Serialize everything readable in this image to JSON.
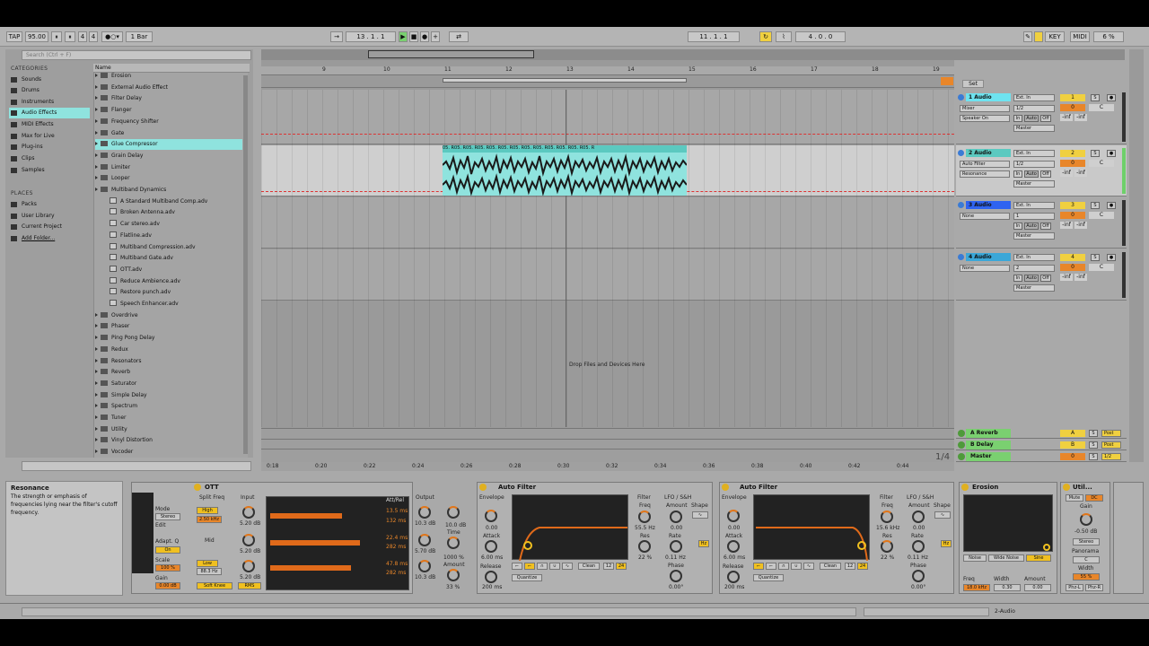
{
  "transport": {
    "tap": "TAP",
    "tempo": "95.00",
    "signature_num": "4",
    "signature_den": "4",
    "quantize": "1 Bar",
    "position": "13 . 1 . 1",
    "loop_start": "11 . 1 . 1",
    "loop_length": "4 . 0 . 0",
    "key": "KEY",
    "midi": "MIDI",
    "cpu": "6 %"
  },
  "browser": {
    "search_placeholder": "Search (Ctrl + F)",
    "categories_label": "CATEGORIES",
    "categories": [
      "Sounds",
      "Drums",
      "Instruments",
      "Audio Effects",
      "MIDI Effects",
      "Max for Live",
      "Plug-ins",
      "Clips",
      "Samples"
    ],
    "places_label": "PLACES",
    "places": [
      "Packs",
      "User Library",
      "Current Project",
      "Add Folder..."
    ],
    "name_header": "Name",
    "items_top": [
      "Erosion",
      "External Audio Effect",
      "Filter Delay",
      "Flanger",
      "Frequency Shifter",
      "Gate",
      "Glue Compressor",
      "Grain Delay",
      "Limiter",
      "Looper",
      "Multiband Dynamics"
    ],
    "presets": [
      "A Standard Multiband Comp.adv",
      "Broken Antenna.adv",
      "Car stereo.adv",
      "Flatline.adv",
      "Multiband Compression.adv",
      "Multiband Gate.adv",
      "OTT.adv",
      "Reduce Ambience.adv",
      "Restore punch.adv",
      "Speech Enhancer.adv"
    ],
    "items_bottom": [
      "Overdrive",
      "Phaser",
      "Ping Pong Delay",
      "Redux",
      "Resonators",
      "Reverb",
      "Saturator",
      "Simple Delay",
      "Spectrum",
      "Tuner",
      "Utility",
      "Vinyl Distortion",
      "Vocoder"
    ]
  },
  "arrangement": {
    "ruler": [
      "9",
      "10",
      "11",
      "12",
      "13",
      "14",
      "15",
      "16",
      "17",
      "18",
      "19"
    ],
    "times": [
      "0:18",
      "0:20",
      "0:22",
      "0:24",
      "0:26",
      "0:28",
      "0:30",
      "0:32",
      "0:34",
      "0:36",
      "0:38",
      "0:40",
      "0:42",
      "0:44"
    ],
    "drop_text": "Drop Files and Devices Here",
    "clip_label": "05.  R05.  R05.  R05.  R05.  R05.  R05.  R05.  R05.  R05.  R05.  R05.  R05.  R",
    "page": "1/4",
    "set_label": "Set"
  },
  "tracks": [
    {
      "name": "1 Audio",
      "color": "#6ee3f0",
      "num": "1",
      "in": "Ext. In",
      "ch": "1/2",
      "dev": "Mixer",
      "param": "Speaker On",
      "out": "Master",
      "vol": "0",
      "pan": "C",
      "inf": "-inf"
    },
    {
      "name": "2 Audio",
      "color": "#5bc9c0",
      "num": "2",
      "in": "Ext. In",
      "ch": "1/2",
      "dev": "Auto Filter",
      "param": "Resonance",
      "out": "Master",
      "vol": "0",
      "pan": "C",
      "inf": "-inf"
    },
    {
      "name": "3 Audio",
      "color": "#2f63f0",
      "num": "3",
      "in": "Ext. In",
      "ch": "1",
      "dev": "None",
      "param": "",
      "out": "Master",
      "vol": "0",
      "pan": "C",
      "inf": "-inf"
    },
    {
      "name": "4 Audio",
      "color": "#3ba7d8",
      "num": "4",
      "in": "Ext. In",
      "ch": "2",
      "dev": "None",
      "param": "",
      "out": "Master",
      "vol": "0",
      "pan": "C",
      "inf": "-inf"
    }
  ],
  "returns": [
    {
      "name": "A Reverb",
      "letter": "A",
      "color": "#7ad070",
      "post": "Post"
    },
    {
      "name": "B Delay",
      "letter": "B",
      "color": "#7ad070",
      "post": "Post"
    },
    {
      "name": "Master",
      "letter": "0",
      "color": "#7ad070",
      "post": "1/2"
    }
  ],
  "info": {
    "title": "Resonance",
    "body": "The strength or emphasis of frequencies lying near the filter's cutoff frequency."
  },
  "devices": {
    "ott": {
      "title": "OTT",
      "split": "Split Freq",
      "input": "Input",
      "output": "Output",
      "high": "High",
      "high_freq": "2.50 kHz",
      "mid": "Mid",
      "low": "Low",
      "low_freq": "88.3 Hz",
      "db1": "5.20 dB",
      "db2": "5.20 dB",
      "db3": "5.20 dB",
      "out1": "10.3 dB",
      "out2": "5.70 dB",
      "out3": "10.3 dB",
      "soft": "Soft Knee",
      "rms": "RMS",
      "time": "Time",
      "time_val": "1000 %",
      "amount": "Amount",
      "amount_val": "33 %",
      "outval": "10.0 dB",
      "att_rel": "Att/Rel",
      "ms1": "13.5 ms",
      "ms2": "132 ms",
      "ms3": "22.4 ms",
      "ms4": "282 ms",
      "ms5": "47.8 ms",
      "ms6": "282 ms",
      "mode": "Mode",
      "stereo": "Stereo",
      "edit": "Edit",
      "adapt": "Adapt. Q",
      "on": "On",
      "scale": "Scale",
      "scale_val": "100 %",
      "gain": "Gain",
      "gain_val": "0.00 dB"
    },
    "af1": {
      "title": "Auto Filter",
      "envelope": "Envelope",
      "env_val": "0.00",
      "attack": "Attack",
      "attack_val": "6.00 ms",
      "release": "Release",
      "release_val": "200 ms",
      "filter": "Filter",
      "freq": "Freq",
      "freq_val": "55.5 Hz",
      "res": "Res",
      "res_val": "22 %",
      "lfo": "LFO / S&H",
      "amount": "Amount",
      "amount_val": "0.00",
      "shape": "Shape",
      "rate": "Rate",
      "rate_val": "0.11 Hz",
      "phase": "Phase",
      "phase_val": "0.00°",
      "clean": "Clean",
      "quantize": "Quantize"
    },
    "af2": {
      "title": "Auto Filter",
      "envelope": "Envelope",
      "env_val": "0.00",
      "attack": "Attack",
      "attack_val": "6.00 ms",
      "release": "Release",
      "release_val": "200 ms",
      "filter": "Filter",
      "freq": "Freq",
      "freq_val": "15.6 kHz",
      "res": "Res",
      "res_val": "22 %",
      "lfo": "LFO / S&H",
      "amount": "Amount",
      "amount_val": "0.00",
      "shape": "Shape",
      "rate": "Rate",
      "rate_val": "0.11 Hz",
      "phase": "Phase",
      "phase_val": "0.00°",
      "clean": "Clean",
      "quantize": "Quantize"
    },
    "erosion": {
      "title": "Erosion",
      "noise": "Noise",
      "wide": "Wide Noise",
      "sine": "Sine",
      "freq": "Freq",
      "freq_val": "18.0 kHz",
      "width": "Width",
      "width_val": "0.30",
      "amount": "Amount",
      "amount_val": "0.00"
    },
    "utility": {
      "title": "Util...",
      "mute": "Mute",
      "dc": "DC",
      "gain": "Gain",
      "gain_val": "-0.50 dB",
      "stereo": "Stereo",
      "panorama": "Panorama",
      "pan_val": "C",
      "width": "Width",
      "width_val": "55 %",
      "phzl": "Phz-L",
      "phzr": "Phz-R"
    }
  },
  "status": {
    "track": "2-Audio"
  }
}
